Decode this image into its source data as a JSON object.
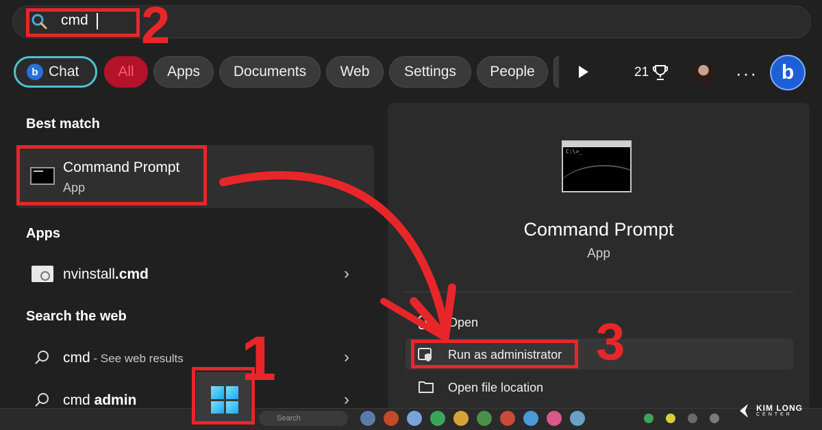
{
  "search": {
    "query": "cmd"
  },
  "filters": {
    "chat_label": "Chat",
    "items": [
      "All",
      "Apps",
      "Documents",
      "Web",
      "Settings",
      "People"
    ],
    "points": "21"
  },
  "left": {
    "best_match_heading": "Best match",
    "best_match": {
      "title": "Command Prompt",
      "subtitle": "App"
    },
    "apps_heading": "Apps",
    "apps": [
      {
        "name_plain": "nvinstall",
        "name_bold": ".cmd"
      }
    ],
    "web_heading": "Search the web",
    "web_results": [
      {
        "query": "cmd",
        "suffix": " - See web results"
      },
      {
        "query_plain": "cmd ",
        "query_bold": "admin"
      }
    ]
  },
  "right": {
    "title": "Command Prompt",
    "subtitle": "App",
    "actions": [
      "Open",
      "Run as administrator",
      "Open file location"
    ]
  },
  "annotations": {
    "step1": "1",
    "step2": "2",
    "step3": "3",
    "color": "#e8262a"
  },
  "watermark": {
    "line1": "KIM LONG",
    "line2": "CENTER"
  },
  "colors": {
    "background": "#202020",
    "panel": "#2b2b2b",
    "accent_chat": "#4cc2d1",
    "all_chip": "#b3122a"
  }
}
